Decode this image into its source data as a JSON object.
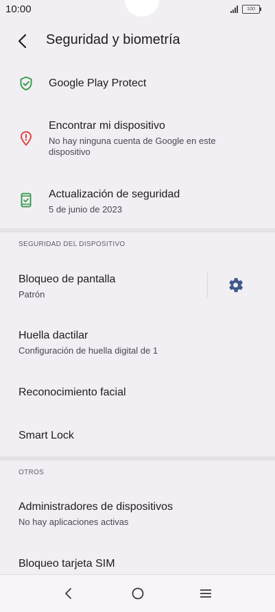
{
  "status": {
    "time": "10:00",
    "battery": "100"
  },
  "header": {
    "title": "Seguridad y biometría"
  },
  "top_items": [
    {
      "title": "Google Play Protect",
      "icon": "shield-check-icon"
    },
    {
      "title": "Encontrar mi dispositivo",
      "subtitle": "No hay ninguna cuenta de Google en este dispositivo",
      "icon": "location-alert-icon"
    },
    {
      "title": "Actualización de seguridad",
      "subtitle": "5 de junio de 2023",
      "icon": "phone-update-icon"
    }
  ],
  "device_security": {
    "header": "SEGURIDAD DEL DISPOSITIVO",
    "items": [
      {
        "title": "Bloqueo de pantalla",
        "subtitle": "Patrón"
      },
      {
        "title": "Huella dactilar",
        "subtitle": "Configuración de huella digital de 1"
      },
      {
        "title": "Reconocimiento facial"
      },
      {
        "title": "Smart Lock"
      }
    ]
  },
  "others": {
    "header": "OTROS",
    "items": [
      {
        "title": "Administradores de dispositivos",
        "subtitle": "No hay aplicaciones activas"
      },
      {
        "title": "Bloqueo tarjeta SIM"
      }
    ]
  },
  "colors": {
    "green": "#3a9e4f",
    "red": "#e0413b",
    "gear": "#3f5a8a"
  }
}
